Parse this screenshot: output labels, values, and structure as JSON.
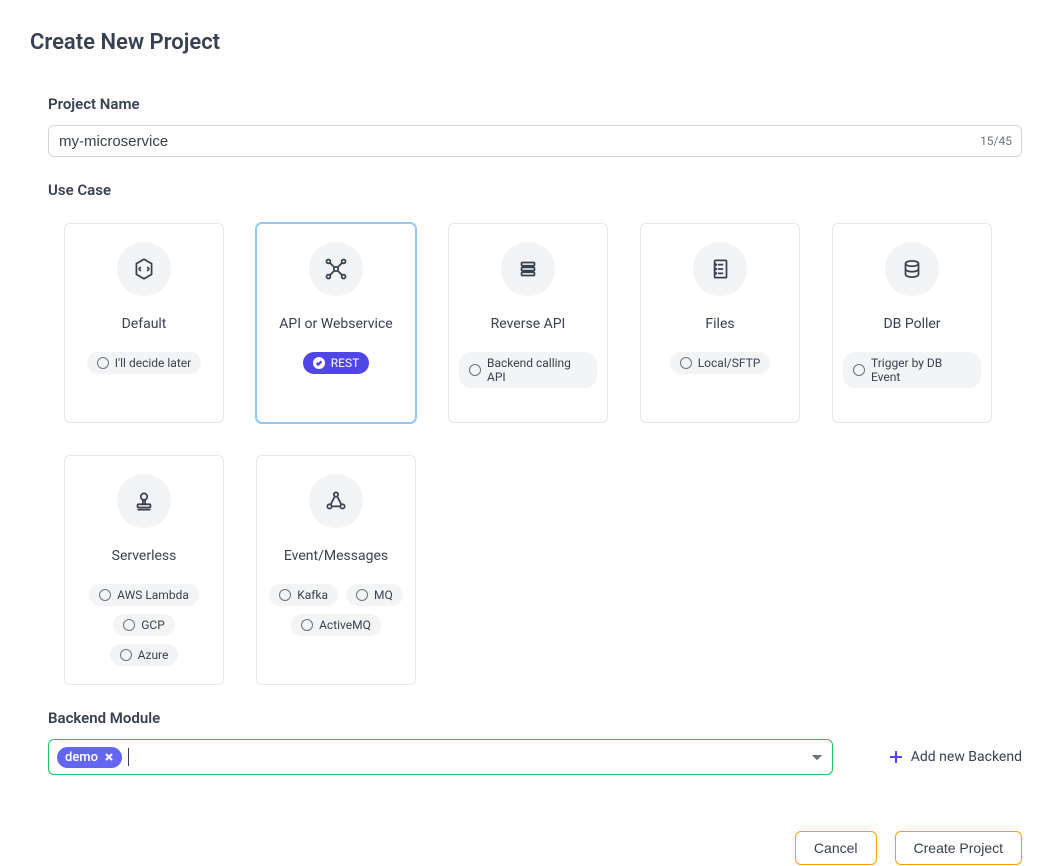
{
  "title": "Create New Project",
  "projectName": {
    "label": "Project Name",
    "value": "my-microservice",
    "charCount": "15/45"
  },
  "useCase": {
    "label": "Use Case",
    "cards": [
      {
        "title": "Default",
        "pills": [
          {
            "label": "I'll decide later",
            "active": false
          }
        ],
        "selected": false
      },
      {
        "title": "API or Webservice",
        "pills": [
          {
            "label": "REST",
            "active": true
          }
        ],
        "selected": true
      },
      {
        "title": "Reverse API",
        "pills": [
          {
            "label": "Backend calling API",
            "active": false
          }
        ],
        "selected": false
      },
      {
        "title": "Files",
        "pills": [
          {
            "label": "Local/SFTP",
            "active": false
          }
        ],
        "selected": false
      },
      {
        "title": "DB Poller",
        "pills": [
          {
            "label": "Trigger by DB Event",
            "active": false
          }
        ],
        "selected": false
      },
      {
        "title": "Serverless",
        "pills": [
          {
            "label": "AWS Lambda",
            "active": false
          },
          {
            "label": "GCP",
            "active": false
          },
          {
            "label": "Azure",
            "active": false
          }
        ],
        "selected": false
      },
      {
        "title": "Event/Messages",
        "pills": [
          {
            "label": "Kafka",
            "active": false
          },
          {
            "label": "MQ",
            "active": false
          },
          {
            "label": "ActiveMQ",
            "active": false
          }
        ],
        "selected": false
      }
    ]
  },
  "backend": {
    "label": "Backend Module",
    "tags": [
      "demo"
    ],
    "addLabel": "Add new Backend"
  },
  "footer": {
    "cancel": "Cancel",
    "create": "Create Project"
  },
  "icons": {
    "default": "hexagon-refresh",
    "api": "network-nodes",
    "reverse": "server-stack",
    "files": "document-list",
    "db": "database",
    "serverless": "stamp",
    "events": "webhook"
  }
}
